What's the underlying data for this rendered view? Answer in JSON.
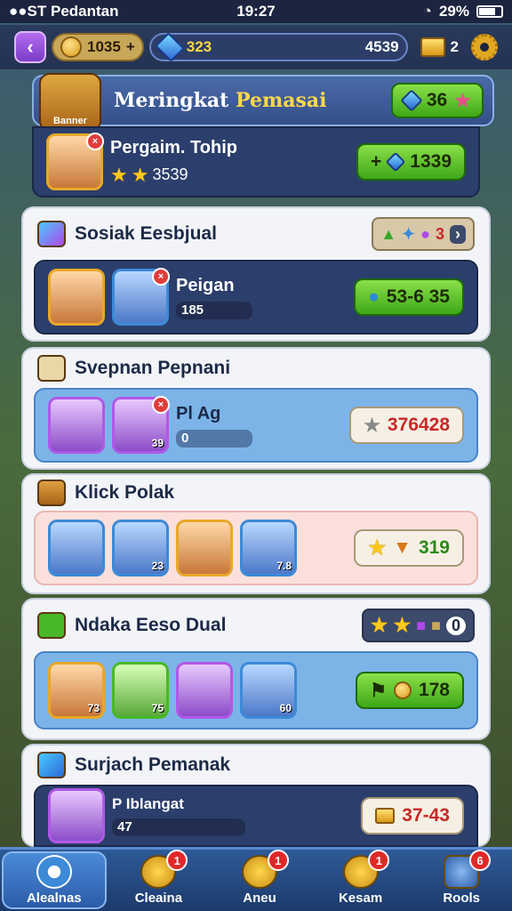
{
  "status": {
    "carrier": "●●ST Pedantan",
    "time": "19:27",
    "battery": "29%"
  },
  "resources": {
    "coins": "1035",
    "gem_label": "323",
    "gems_total": "4539",
    "gold_count": "2"
  },
  "title": {
    "main": "Meringkat",
    "accent": "Pemasai",
    "badge": "36",
    "logo": "Banner"
  },
  "header_row": {
    "name": "Pergaim. Tohip",
    "score": "3539",
    "button_value": "1339"
  },
  "sections": [
    {
      "title": "Sosiak Eesbjual",
      "reward_value": "3",
      "row": {
        "name": "Peigan",
        "progress": "185",
        "button_value": "53-6 35"
      }
    },
    {
      "title": "Svepnan Pepnani",
      "row": {
        "name": "Pl Ag",
        "avatar_level": "39",
        "progress": "0",
        "button_value": "376428"
      }
    },
    {
      "title": "Klick Polak",
      "row": {
        "levels": [
          "",
          "23",
          "",
          "7.8"
        ],
        "button_value": "319"
      }
    },
    {
      "title": "Ndaka Eeso Dual",
      "reward_value": "0",
      "row": {
        "levels": [
          "73",
          "75",
          "",
          "60"
        ],
        "button_value": "178"
      }
    },
    {
      "title": "Surjach Pemanak",
      "row": {
        "name": "P Iblangat",
        "progress": "47",
        "button_value": "37-43"
      }
    }
  ],
  "nav": {
    "items": [
      {
        "label": "Alealnas",
        "badge": ""
      },
      {
        "label": "Cleaina",
        "badge": "1"
      },
      {
        "label": "Aneu",
        "badge": "1"
      },
      {
        "label": "Kesam",
        "badge": "1"
      },
      {
        "label": "Rools",
        "badge": "6"
      }
    ]
  }
}
